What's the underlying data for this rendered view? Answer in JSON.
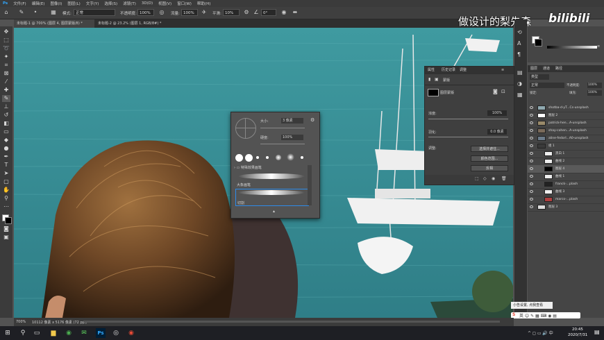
{
  "menu": [
    "文件(F)",
    "编辑(E)",
    "图像(I)",
    "图层(L)",
    "文字(Y)",
    "选择(S)",
    "滤镜(T)",
    "3D(D)",
    "视图(V)",
    "窗口(W)",
    "帮助(H)"
  ],
  "options": {
    "mode_label": "模式:",
    "mode_value": "正常",
    "opacity_label": "不透明度:",
    "opacity_value": "100%",
    "flow_label": "流量:",
    "flow_value": "100%",
    "smooth_label": "平滑:",
    "smooth_value": "10%",
    "angle_value": "0°"
  },
  "tabs": [
    "未标题-1 @ 700% (图层 4, 图层蒙版/8) *",
    "未标题-2 @ 23.2% (图层 1, RGB/8#) *"
  ],
  "watermark": {
    "text": "做设计的梨先森",
    "logo": "bilibili"
  },
  "brush_popup": {
    "size_label": "大小:",
    "size_value": "3 像素",
    "hardness_label": "硬度:",
    "hardness_value": "100%",
    "group1": "特殊效果画笔",
    "group2": "大象画笔",
    "group3": "切割"
  },
  "properties": {
    "tabs": [
      "属性",
      "历史记录",
      "调整"
    ],
    "subtitle": "蒙版",
    "mask_label": "图层蒙版",
    "density_label": "浓度:",
    "density_value": "100%",
    "feather_label": "羽化:",
    "feather_value": "0.0 像素",
    "adjust_label": "调整:",
    "btn_select": "选择并遮住...",
    "btn_color_range": "颜色范围...",
    "btn_invert": "反相"
  },
  "layers_panel": {
    "tabs": [
      "图层",
      "通道",
      "路径"
    ],
    "filter_value": "类型",
    "blend_value": "正常",
    "opacity_label": "不透明度:",
    "opacity_value": "100%",
    "lock_label": "锁定:",
    "fill_label": "填充:",
    "fill_value": "100%",
    "layers": [
      {
        "name": "shotba-d-yT...Cs-unsplash",
        "indent": 0
      },
      {
        "name": "图层 2",
        "indent": 0
      },
      {
        "name": "patrick-hen...A-unsplash",
        "indent": 0
      },
      {
        "name": "shay-cohen...A-unsplash",
        "indent": 0
      },
      {
        "name": "aline-fedorl...A0-unsplash",
        "indent": 0
      },
      {
        "name": "组 1",
        "indent": 0
      },
      {
        "name": "黑白 1",
        "indent": 1
      },
      {
        "name": "曲线 2",
        "indent": 1
      },
      {
        "name": "图层 4",
        "indent": 1
      },
      {
        "name": "曲线 1",
        "indent": 1
      },
      {
        "name": "franck-...plash",
        "indent": 1
      },
      {
        "name": "曲线 3",
        "indent": 1
      },
      {
        "name": "marco-...plash",
        "indent": 1
      },
      {
        "name": "图层 3",
        "indent": 0
      }
    ]
  },
  "status": {
    "zoom": "700%",
    "doc": "10112 像素 x 5176 像素 (72 ppi)"
  },
  "tooltip": "小告设置, 点我查看",
  "taskbar": {
    "time": "20:45",
    "date": "2020/7/31"
  },
  "colors": {
    "accent": "#2d8ceb",
    "canvas_sea": "#3a8f96",
    "panel_bg": "#454545"
  }
}
